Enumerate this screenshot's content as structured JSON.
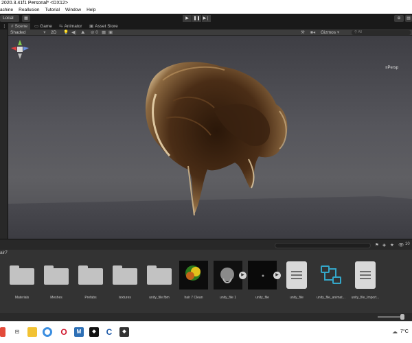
{
  "title": "2020.3.41f1 Personal* <DX12>",
  "menu": [
    "achine",
    "Reallusion",
    "Tutorial",
    "Window",
    "Help"
  ],
  "toolbar": {
    "local_label": "Local",
    "play": "▶",
    "pause": "❚❚",
    "step": "▶❘"
  },
  "tabs": [
    {
      "label": "Scene",
      "icon": "hash-icon"
    },
    {
      "label": "Game",
      "icon": "game-icon"
    },
    {
      "label": "Animator",
      "icon": "animator-icon"
    },
    {
      "label": "Asset Store",
      "icon": "store-icon"
    }
  ],
  "scene_toolbar": {
    "shading_mode": "Shaded",
    "mode_2d": "2D",
    "gizmos_label": "Gizmos",
    "search_placeholder": "All"
  },
  "viewport": {
    "persp_label": "≡Persp"
  },
  "project": {
    "breadcrumb": "air7",
    "count": "10"
  },
  "assets": [
    {
      "name": "Materials",
      "kind": "folder"
    },
    {
      "name": "Meshes",
      "kind": "folder"
    },
    {
      "name": "Prefabs",
      "kind": "folder"
    },
    {
      "name": "textures",
      "kind": "folder"
    },
    {
      "name": "unity_file.fbm",
      "kind": "folder"
    },
    {
      "name": "hair 7 Clean",
      "kind": "texture"
    },
    {
      "name": "unity_file 1",
      "kind": "model"
    },
    {
      "name": "unity_file",
      "kind": "model"
    },
    {
      "name": "unity_file",
      "kind": "document"
    },
    {
      "name": "unity_file_animat...",
      "kind": "animator"
    },
    {
      "name": "unity_file_Import...",
      "kind": "document"
    }
  ],
  "taskbar": {
    "temperature": "7°C"
  },
  "colors": {
    "accent": "#34a7c9",
    "hair_dark": "#3b2414",
    "hair_light": "#d9b98c"
  }
}
